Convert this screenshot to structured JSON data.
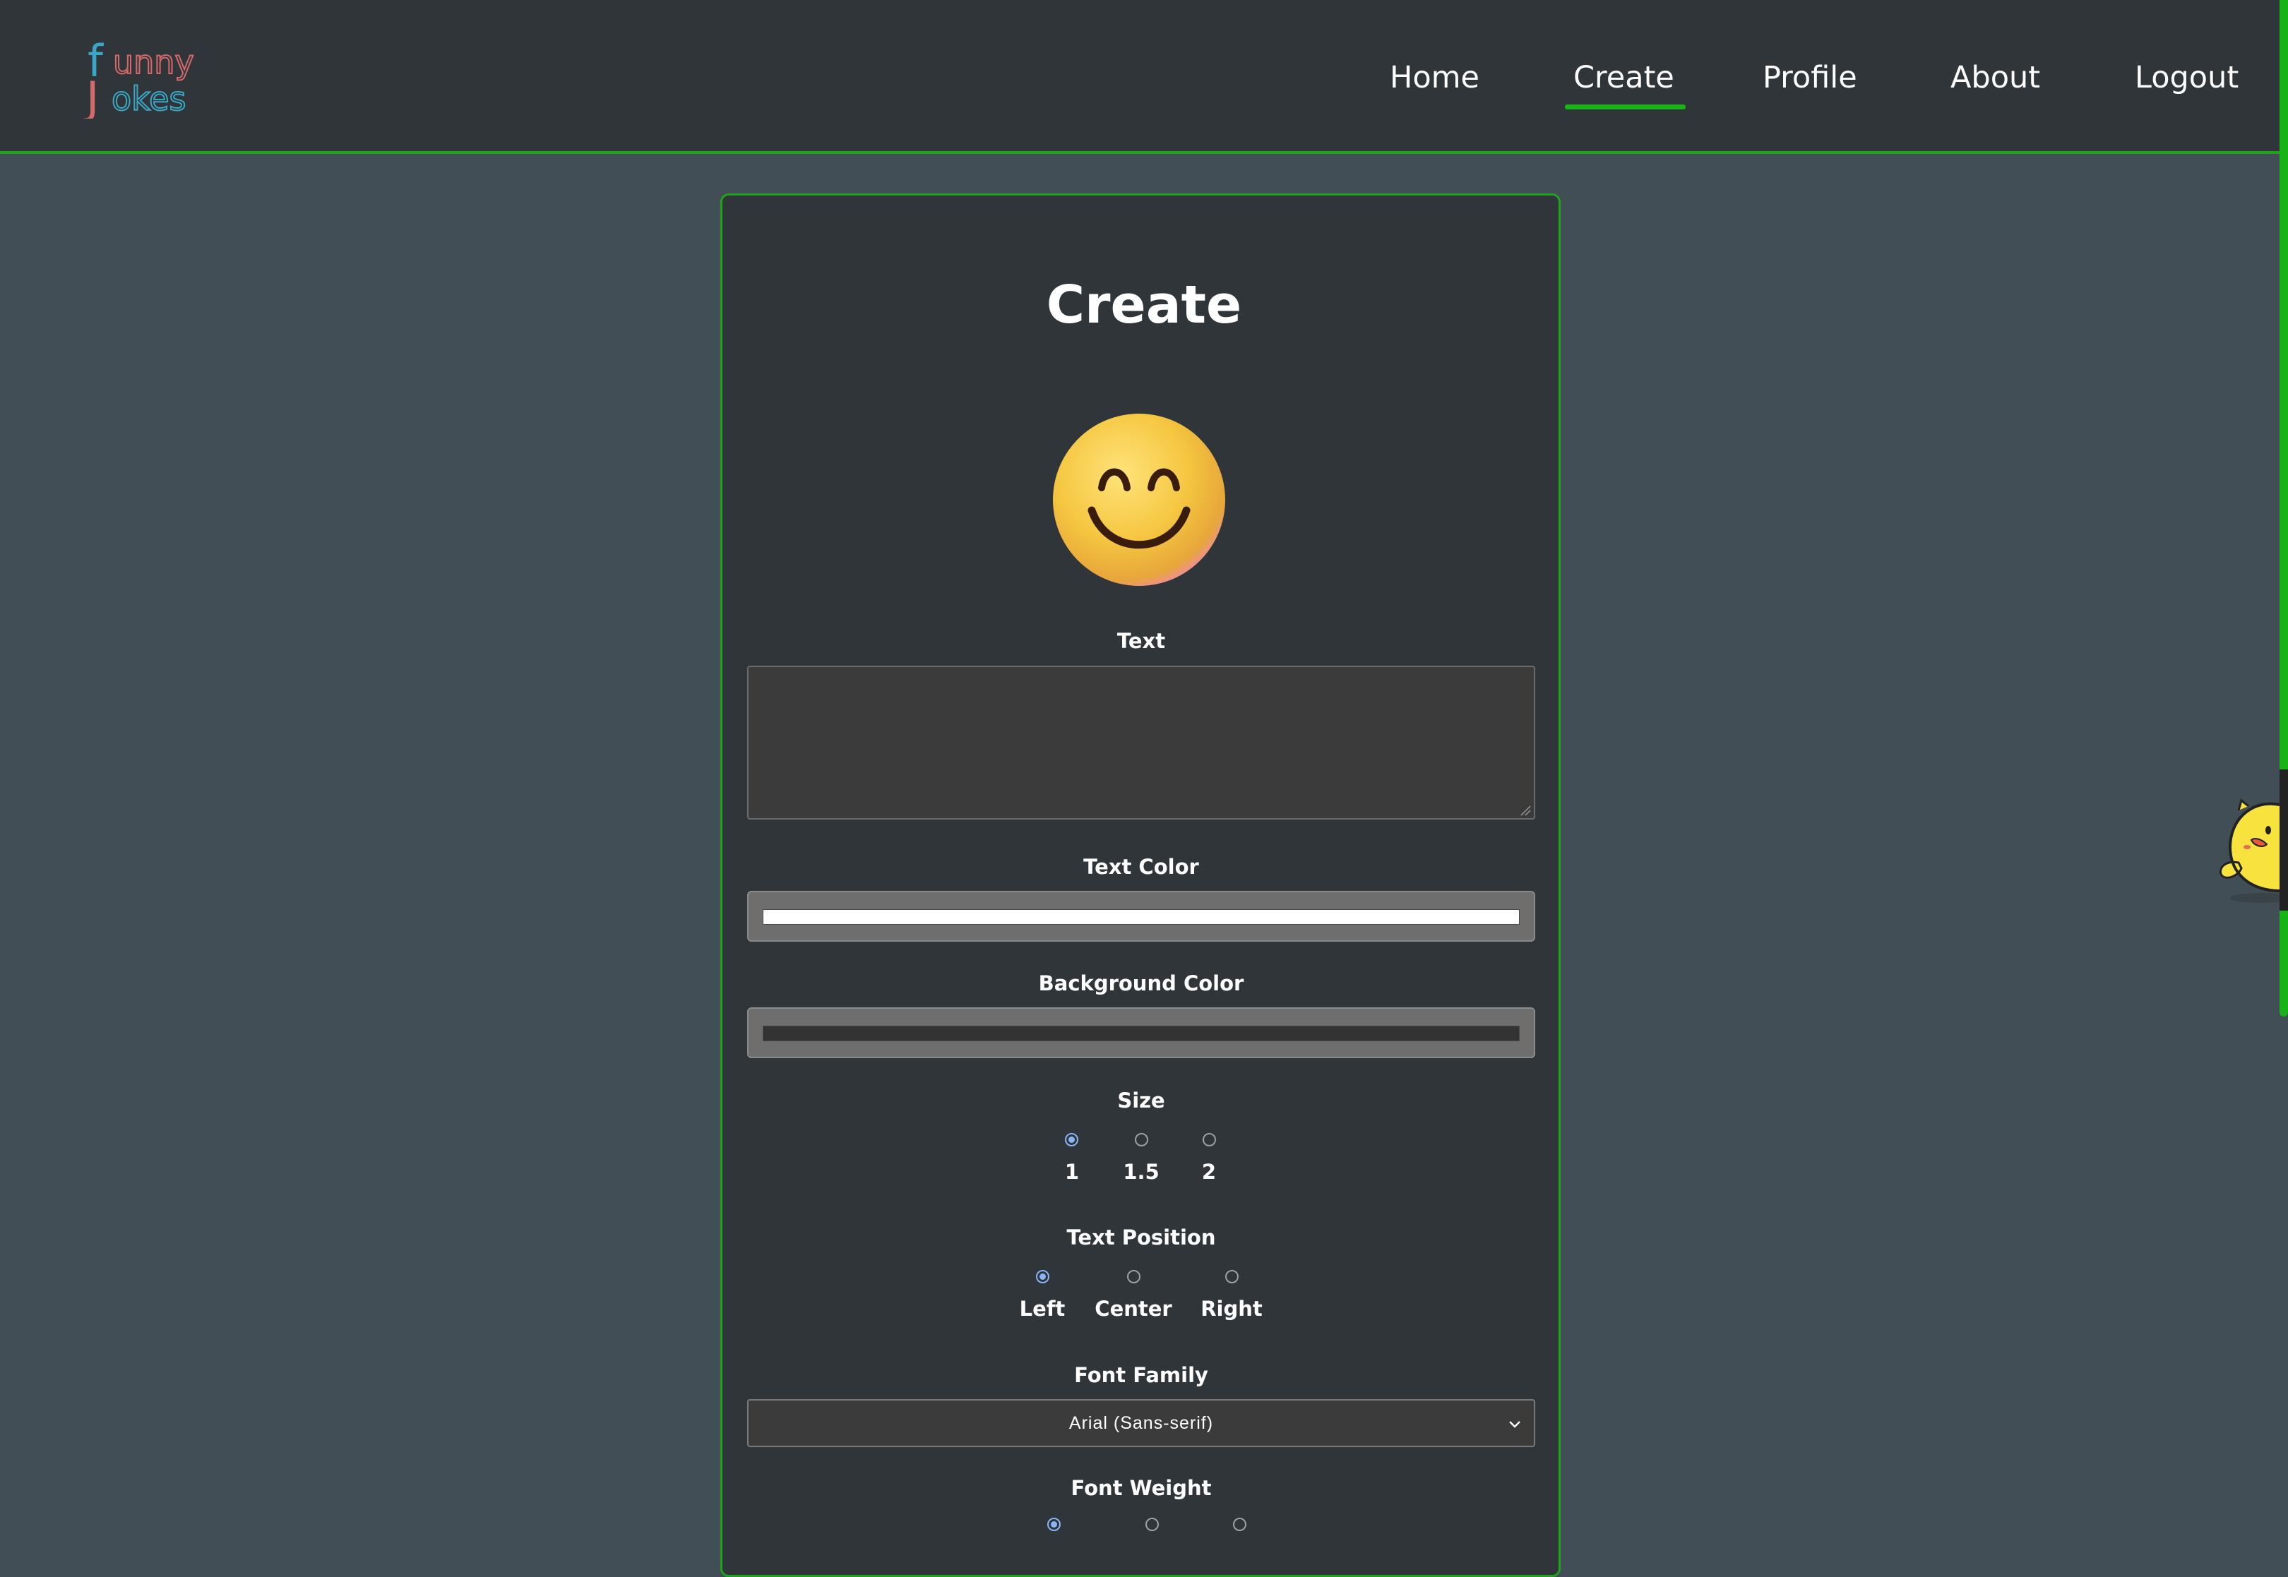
{
  "header": {
    "logo_text": "Funny Jokes",
    "nav": [
      {
        "label": "Home",
        "active": false
      },
      {
        "label": "Create",
        "active": true
      },
      {
        "label": "Profile",
        "active": false
      },
      {
        "label": "About",
        "active": false
      },
      {
        "label": "Logout",
        "active": false
      }
    ]
  },
  "form": {
    "title": "Create",
    "preview_icon": "smiley-face-icon",
    "text": {
      "label": "Text",
      "value": ""
    },
    "text_color": {
      "label": "Text Color",
      "value": "#ffffff"
    },
    "background_color": {
      "label": "Background Color",
      "value": "#333333"
    },
    "size": {
      "label": "Size",
      "options": [
        "1",
        "1.5",
        "2"
      ],
      "selected": "1"
    },
    "text_position": {
      "label": "Text Position",
      "options": [
        "Left",
        "Center",
        "Right"
      ],
      "selected": "Left"
    },
    "font_family": {
      "label": "Font Family",
      "value": "Arial (Sans-serif)"
    },
    "font_weight": {
      "label": "Font Weight"
    }
  },
  "colors": {
    "accent": "#17b317",
    "page_bg": "#414e55",
    "panel_bg": "#2f3539"
  },
  "mascot_icon": "chick-mascot-icon"
}
